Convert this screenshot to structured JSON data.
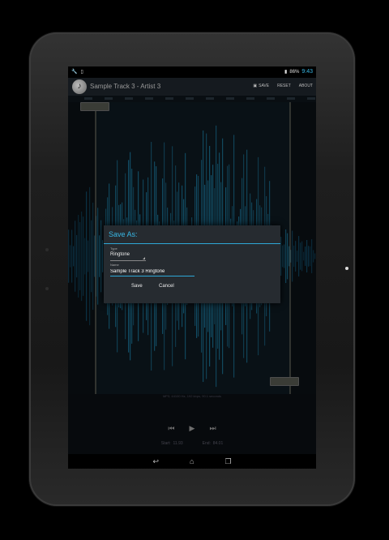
{
  "status_bar": {
    "battery": "86%",
    "time": "9:43"
  },
  "action_bar": {
    "title": "Sample Track 3 - Artist 3",
    "actions": [
      "SAVE",
      "RESET",
      "ABOUT"
    ]
  },
  "dialog": {
    "title": "Save As:",
    "type_label": "Type",
    "type_value": "Ringtone",
    "name_label": "Name",
    "name_value": "Sample Track 3 Ringtone",
    "save_label": "Save",
    "cancel_label": "Cancel"
  },
  "info": "MP3, 44100 Hz, 192 kbps, 90.1 seconds",
  "times": {
    "start_label": "Start:",
    "start_value": "11.93",
    "end_label": "End:",
    "end_value": "84.01"
  },
  "icons": {
    "wrench": "wrench-icon",
    "battery": "battery-icon",
    "back": "back-icon",
    "home": "home-icon",
    "recents": "recents-icon"
  }
}
